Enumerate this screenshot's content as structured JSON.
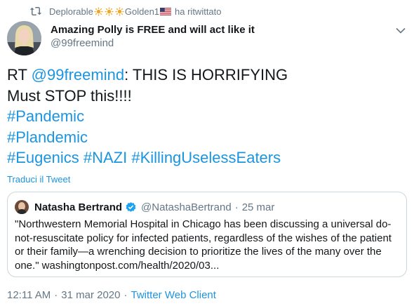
{
  "retweet": {
    "user_name_part": "Deplorable",
    "user_name_part2": "Golden1",
    "suffix": "ha ritwittato"
  },
  "author": {
    "name": "Amazing Polly is FREE and will act like it",
    "handle": "@99freemind"
  },
  "tweet": {
    "rt_prefix": "RT ",
    "mention": "@99freemind",
    "headline": ": THIS IS HORRIFYING",
    "line2": "Must STOP this!!!!",
    "hashtag1": "#Pandemic",
    "hashtag2": "#Plandemic",
    "hashtag3": "#Eugenics",
    "hashtag4": "#NAZI",
    "hashtag5": "#KillingUselessEaters"
  },
  "translate_label": "Traduci il Tweet",
  "quoted": {
    "name": "Natasha Bertrand",
    "handle": "@NatashaBertrand",
    "separator": "·",
    "date": "25 mar",
    "text": "\"Northwestern Memorial Hospital in Chicago has been discussing a universal do-not-resuscitate policy for infected patients, regardless of the wishes of the patient or their family—a wrenching decision to prioritize the lives of the many over the one.\" washingtonpost.com/health/2020/03..."
  },
  "footer": {
    "time": "12:11 AM",
    "separator1": "·",
    "date": "31 mar 2020",
    "separator2": "·",
    "client": "Twitter Web Client"
  },
  "colors": {
    "text": "#14171a",
    "secondary": "#657786",
    "link": "#1b95e0",
    "border": "#ccd6dd"
  }
}
